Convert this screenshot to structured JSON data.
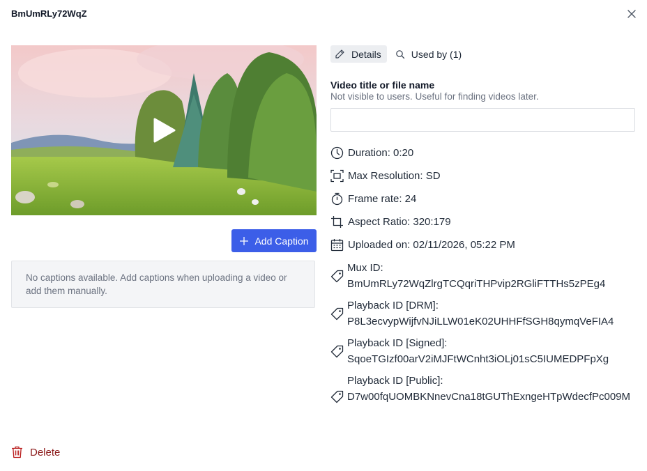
{
  "dialog": {
    "title": "BmUmRLy72WqZ",
    "close_icon": "close-icon"
  },
  "video": {
    "play_icon": "play-icon",
    "add_caption_label": "Add Caption",
    "captions_empty_text": "No captions available. Add captions when uploading a video or add them manually."
  },
  "tabs": [
    {
      "label": "Details",
      "icon": "pencil-icon",
      "active": true
    },
    {
      "label": "Used by (1)",
      "icon": "search-icon",
      "active": false
    }
  ],
  "form": {
    "title_label": "Video title or file name",
    "title_help": "Not visible to users. Useful for finding videos later.",
    "title_value": "",
    "title_placeholder": ""
  },
  "meta": {
    "duration": "Duration: 0:20",
    "max_resolution": "Max Resolution: SD",
    "frame_rate": "Frame rate: 24",
    "aspect_ratio": "Aspect Ratio: 320:179",
    "uploaded_on": "Uploaded on: 02/11/2026, 05:22 PM"
  },
  "ids": {
    "mux_label": "Mux ID:",
    "mux_value": "BmUmRLy72WqZlrgTCQqriTHPvip2RGliFTTHs5zPEg4",
    "drm_label": "Playback ID [DRM]:",
    "drm_value": "P8L3ecvypWijfvNJiLLW01eK02UHHFfSGH8qymqVeFIA4",
    "signed_label": "Playback ID [Signed]:",
    "signed_value": "SqoeTGIzf00arV2iMJFtWCnht3iOLj01sC5IUMEDPFpXg",
    "public_label": "Playback ID [Public]:",
    "public_value": "D7w00fqUOMBKNnevCna18tGUThExngeHTpWdecfPc009M"
  },
  "footer": {
    "delete_label": "Delete",
    "delete_color": "#8b1a1a"
  },
  "colors": {
    "accent": "#3c5ee8"
  }
}
